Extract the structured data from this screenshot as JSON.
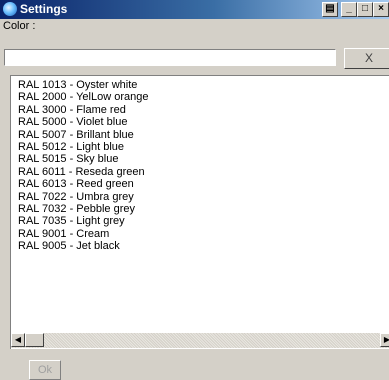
{
  "window": {
    "title": "Settings",
    "controls": {
      "print": "▤",
      "minimize": "_",
      "maximize": "□",
      "close": "×"
    }
  },
  "color_label": "Color :",
  "color_input": {
    "value": "",
    "placeholder": ""
  },
  "clear_button": "X",
  "color_list": [
    "RAL 1013 - Oyster white",
    "RAL 2000 - YelLow orange",
    "RAL 3000 - Flame red",
    "RAL 5000 - Violet blue",
    "RAL 5007 - Brillant blue",
    "RAL 5012 - Light blue",
    "RAL 5015 - Sky blue",
    "RAL 6011 - Reseda green",
    "RAL 6013 - Reed green",
    "RAL 7022 - Umbra grey",
    "RAL 7032 - Pebble grey",
    "RAL 7035 - Light grey",
    "RAL 9001 - Cream",
    "RAL 9005 - Jet black"
  ],
  "scrollbar": {
    "left_arrow": "◀",
    "right_arrow": "▶"
  },
  "ok_button": "Ok"
}
